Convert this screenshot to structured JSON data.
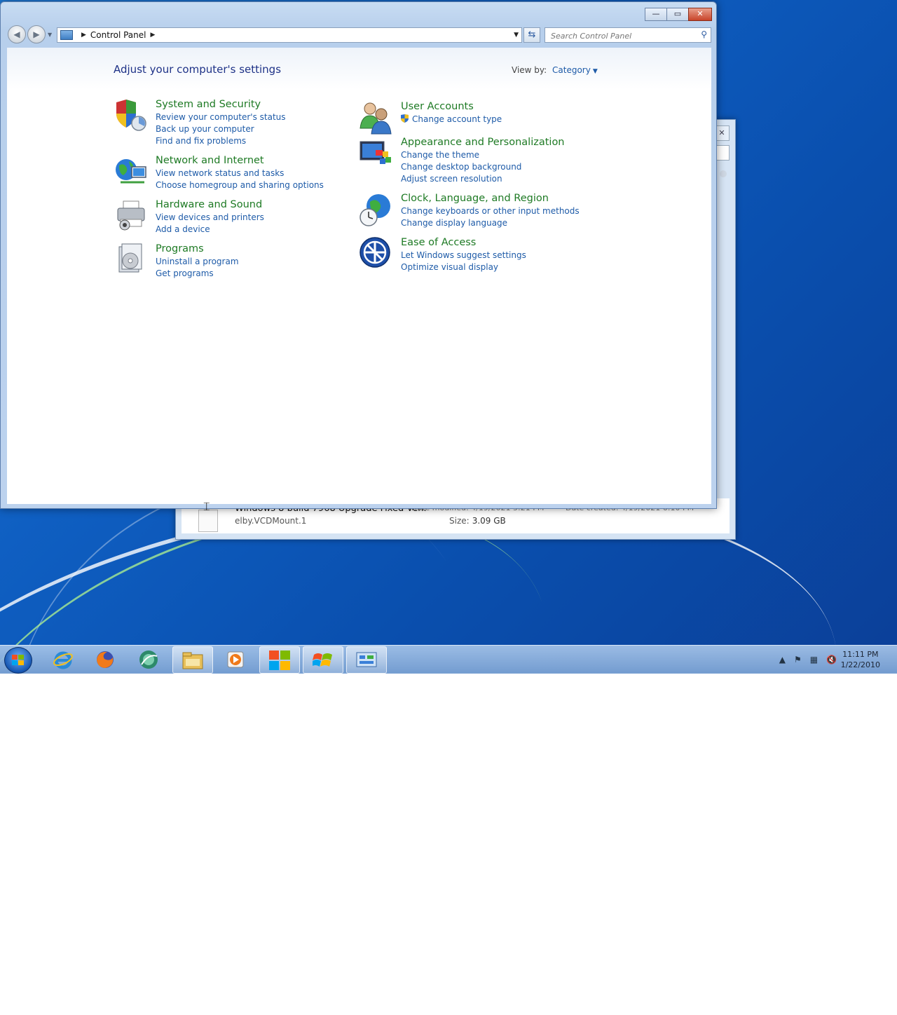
{
  "window": {
    "address": {
      "crumb": "Control Panel"
    },
    "search_placeholder": "Search Control Panel",
    "caption": {
      "minimize": "—",
      "maximize": "▭",
      "close": "✕"
    }
  },
  "content": {
    "title": "Adjust your computer's settings",
    "view_by_label": "View by:",
    "view_by_value": "Category"
  },
  "categories": {
    "system": {
      "head": "System and Security",
      "links": [
        "Review your computer's status",
        "Back up your computer",
        "Find and fix problems"
      ],
      "icon": "security-shield-icon"
    },
    "network": {
      "head": "Network and Internet",
      "links": [
        "View network status and tasks",
        "Choose homegroup and sharing options"
      ],
      "icon": "network-globe-icon"
    },
    "hardware": {
      "head": "Hardware and Sound",
      "links": [
        "View devices and printers",
        "Add a device"
      ],
      "icon": "printer-icon"
    },
    "programs": {
      "head": "Programs",
      "links": [
        "Uninstall a program",
        "Get programs"
      ],
      "icon": "programs-disc-icon"
    },
    "users": {
      "head": "User Accounts",
      "links": [
        "Change account type"
      ],
      "icon": "users-icon"
    },
    "appearance": {
      "head": "Appearance and Personalization",
      "links": [
        "Change the theme",
        "Change desktop background",
        "Adjust screen resolution"
      ],
      "icon": "monitor-paint-icon"
    },
    "clock": {
      "head": "Clock, Language, and Region",
      "links": [
        "Change keyboards or other input methods",
        "Change display language"
      ],
      "icon": "clock-globe-icon"
    },
    "ease": {
      "head": "Ease of Access",
      "links": [
        "Let Windows suggest settings",
        "Optimize visual display"
      ],
      "icon": "ease-of-access-icon"
    }
  },
  "background_window": {
    "file_name": "Windows 8 build 7968 Upgrade Fixed Ven.",
    "date_modified": "Date modified: 4/19/2021 5:21 PM",
    "date_created": "Date created: 4/19/2021 6:10 PM",
    "type": "elby.VCDMount.1",
    "size_label": "Size:",
    "size_value": "3.09 GB"
  },
  "taskbar": {
    "clock_time": "11:11 PM",
    "clock_date": "1/22/2010"
  },
  "colors": {
    "category_head": "#1e7a24",
    "link": "#1e5ba8",
    "title": "#1e3287"
  }
}
